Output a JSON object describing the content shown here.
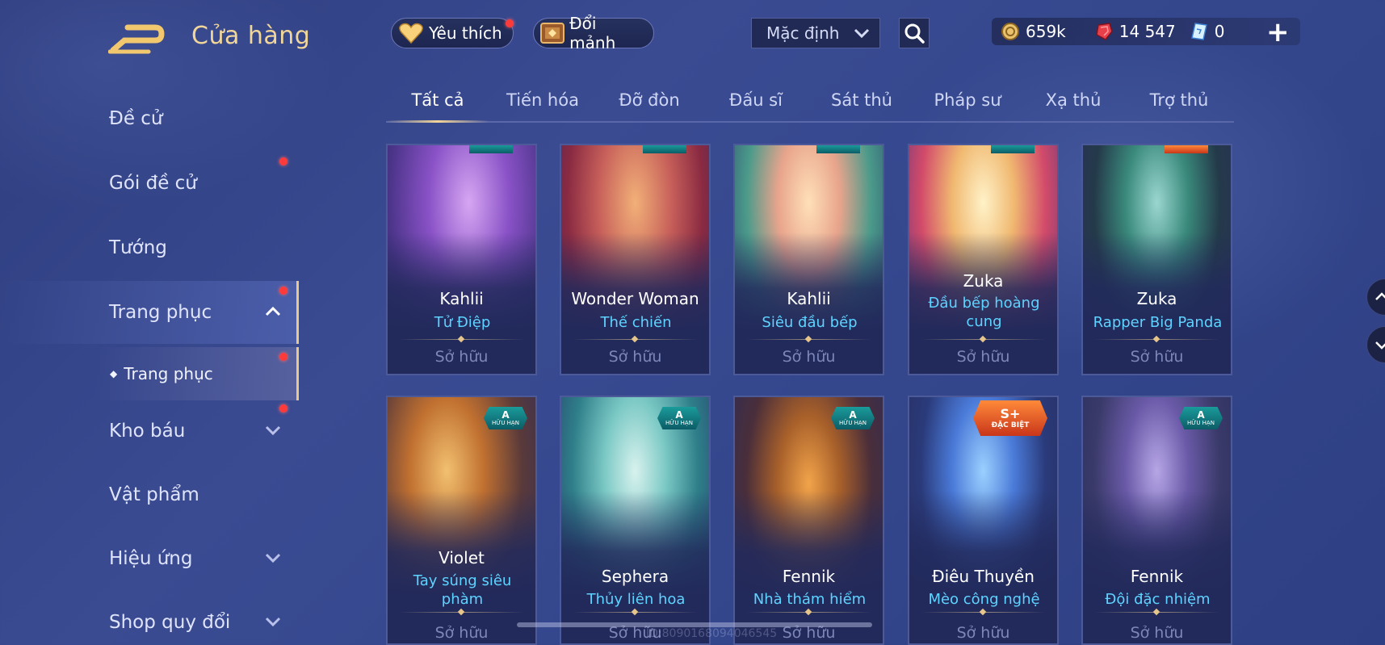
{
  "header": {
    "title": "Cửa hàng",
    "favorite_label": "Yêu thích",
    "shard_label": "Đổi mảnh",
    "sort_value": "Mặc định"
  },
  "currency": {
    "gold": "659k",
    "gems": "14 547",
    "vouchers": "0"
  },
  "sidebar": {
    "items": [
      {
        "label": "Đề cử"
      },
      {
        "label": "Gói đề cử"
      },
      {
        "label": "Tướng"
      },
      {
        "label": "Trang phục"
      },
      {
        "label": "Kho báu"
      },
      {
        "label": "Vật phẩm"
      },
      {
        "label": "Hiệu ứng"
      },
      {
        "label": "Shop quy đổi"
      }
    ],
    "sub_item": "Trang phục"
  },
  "tabs": [
    "Tất cả",
    "Tiến hóa",
    "Đỡ đòn",
    "Đấu sĩ",
    "Sát thủ",
    "Pháp sư",
    "Xạ thủ",
    "Trợ thủ"
  ],
  "owned_label": "Sở hữu",
  "cards": [
    {
      "hero": "Kahlii",
      "skin": "Tử Điệp"
    },
    {
      "hero": "Wonder Woman",
      "skin": "Thế chiến"
    },
    {
      "hero": "Kahlii",
      "skin": "Siêu đầu bếp"
    },
    {
      "hero": "Zuka",
      "skin": "Đầu bếp hoàng cung"
    },
    {
      "hero": "Zuka",
      "skin": "Rapper Big Panda"
    },
    {
      "hero": "Violet",
      "skin": "Tay súng siêu phàm",
      "badge": "A",
      "badge_text": "HỮU HẠN"
    },
    {
      "hero": "Sephera",
      "skin": "Thủy liên hoa",
      "badge": "A",
      "badge_text": "HỮU HẠN"
    },
    {
      "hero": "Fennik",
      "skin": "Nhà thám hiểm",
      "badge": "A",
      "badge_text": "HỮU HẠN"
    },
    {
      "hero": "Điêu Thuyền",
      "skin": "Mèo công nghệ",
      "badge": "S+",
      "badge_text": "ĐẶC BIỆT"
    },
    {
      "hero": "Fennik",
      "skin": "Đội đặc nhiệm",
      "badge": "A",
      "badge_text": "HỮU HẠN"
    }
  ],
  "watermark": "ID:8090168094046545",
  "colors": {
    "accent_gold": "#f1d69a",
    "skin_cyan": "#5fd3ff",
    "notify_red": "#ff3a3a"
  }
}
